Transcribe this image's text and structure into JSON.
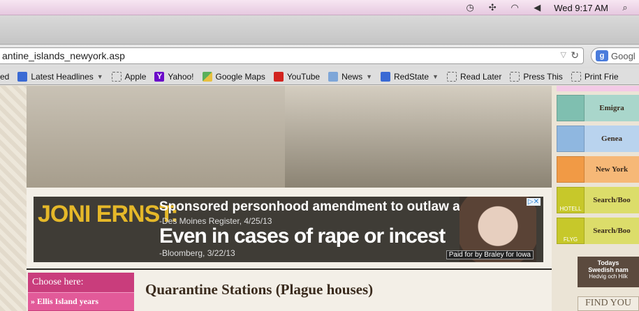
{
  "menubar": {
    "clock": "Wed 9:17 AM"
  },
  "browser": {
    "url": "antine_islands_newyork.asp",
    "search_engine_label": "Googl"
  },
  "bookmarks": [
    {
      "label": "ed",
      "icon": "rss-icon"
    },
    {
      "label": "Latest Headlines",
      "icon": "rss-icon",
      "menu": true
    },
    {
      "label": "Apple",
      "icon": "bookmark-icon"
    },
    {
      "label": "Yahoo!",
      "icon": "yahoo-icon"
    },
    {
      "label": "Google Maps",
      "icon": "maps-icon"
    },
    {
      "label": "YouTube",
      "icon": "youtube-icon"
    },
    {
      "label": "News",
      "icon": "folder-icon",
      "menu": true
    },
    {
      "label": "RedState",
      "icon": "rss-icon",
      "menu": true
    },
    {
      "label": "Read Later",
      "icon": "bookmark-icon"
    },
    {
      "label": "Press This",
      "icon": "bookmark-icon"
    },
    {
      "label": "Print Frie",
      "icon": "bookmark-icon"
    }
  ],
  "ad": {
    "name": "JONI ERNST:",
    "line1": "Sponsored personhood amendment to outlaw abortion",
    "source1": "-Des Moines Register, 4/25/13",
    "line2": "Even in cases of rape or incest",
    "source2": "-Bloomberg, 3/22/13",
    "paid_by": "Paid for by Braley for Iowa"
  },
  "left_menu": {
    "header": "Choose here:",
    "items": [
      "» Ellis Island years"
    ]
  },
  "page_title": "Quarantine Stations (Plague houses)",
  "sidebar": {
    "links": [
      {
        "label": "Emigra",
        "color": "#7fbfb0"
      },
      {
        "label": "Genea",
        "color": "#8fb7e0"
      },
      {
        "label": "New York",
        "color": "#f19a45"
      },
      {
        "label": "Search/Boo",
        "caption": "HOTELL",
        "color": "#c7c82a"
      },
      {
        "label": "Search/Boo",
        "caption": "FLYG",
        "color": "#c7c82a"
      }
    ],
    "today_title": "Todays",
    "today_line1": "Swedish nam",
    "today_line2": "Hedvig och Hilk",
    "find_label": "FIND YOU"
  }
}
